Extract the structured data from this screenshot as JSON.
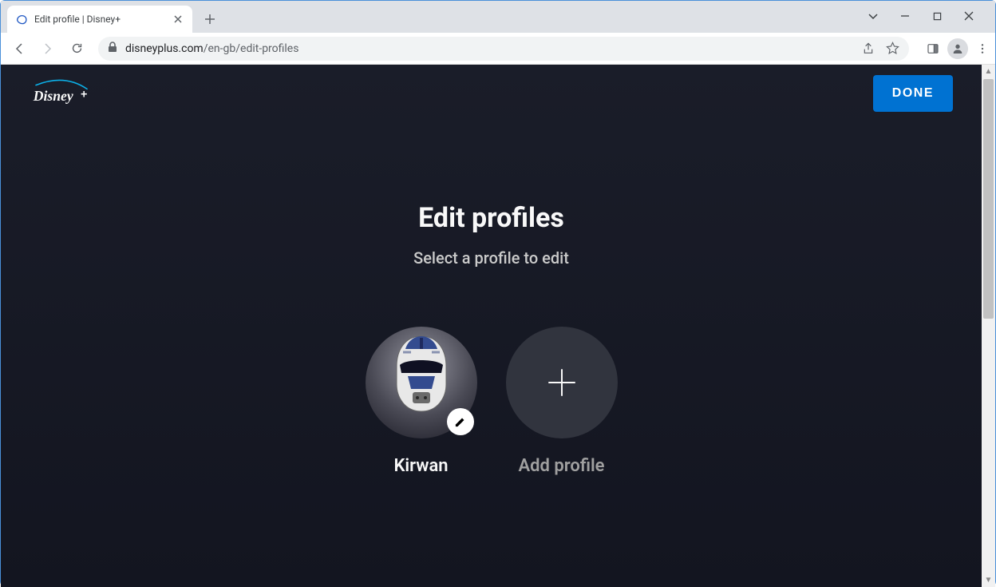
{
  "browser": {
    "tab_title": "Edit profile | Disney+",
    "url_domain": "disneyplus.com",
    "url_path": "/en-gb/edit-profiles"
  },
  "header": {
    "logo_text": "Disney+",
    "done_label": "DONE"
  },
  "main": {
    "title": "Edit profiles",
    "subtitle": "Select a profile to edit"
  },
  "profiles": [
    {
      "name": "Kirwan"
    }
  ],
  "add_profile_label": "Add profile"
}
